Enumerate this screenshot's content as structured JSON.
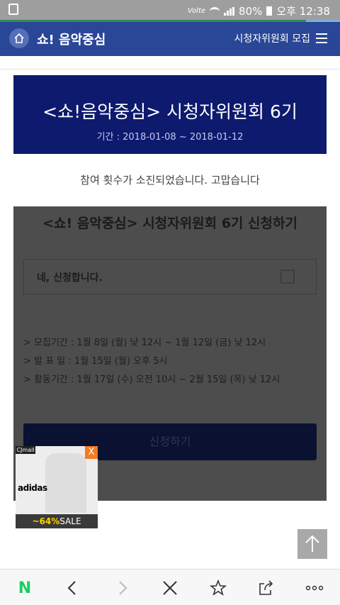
{
  "status_bar": {
    "volte": "Volte",
    "battery": "80%",
    "time": "오후 12:38"
  },
  "browser_progress": 0.9,
  "header": {
    "title": "쇼! 음악중심",
    "link": "시청자위원회 모집",
    "menu_icon": "hamburger-icon",
    "home_icon": "home-icon"
  },
  "banner": {
    "title": "<쇼!음악중심> 시청자위원회 6기",
    "period": "기간 : 2018-01-08 ~ 2018-01-12"
  },
  "notice": "참여 횟수가 소진되었습니다. 고맙습니다",
  "form": {
    "title": "<쇼! 음악중심> 시청자위원회 6기 신청하기",
    "agree_label": "네, 신청합니다.",
    "schedule": [
      "> 모집기간 : 1월 8일 (월) 낮 12시 ~ 1월 12일 (금) 낮 12시",
      "> 발 표 일 : 1월 15일 (월) 오후 5시",
      "> 활동기간 : 1월 17일 (수) 오전 10시 ~ 2월 15일 (목) 낮 12시"
    ],
    "apply_button": "신청하기"
  },
  "ad": {
    "badge": "CJmall",
    "close": "X",
    "brand": "adidas",
    "discount": "~64%",
    "sale": "SALE"
  },
  "bottom_nav": {
    "home": "N",
    "back_icon": "chevron-left-icon",
    "forward_icon": "chevron-right-icon",
    "close_icon": "close-icon",
    "bookmark_icon": "star-icon",
    "share_icon": "share-icon",
    "more_icon": "more-icon"
  }
}
